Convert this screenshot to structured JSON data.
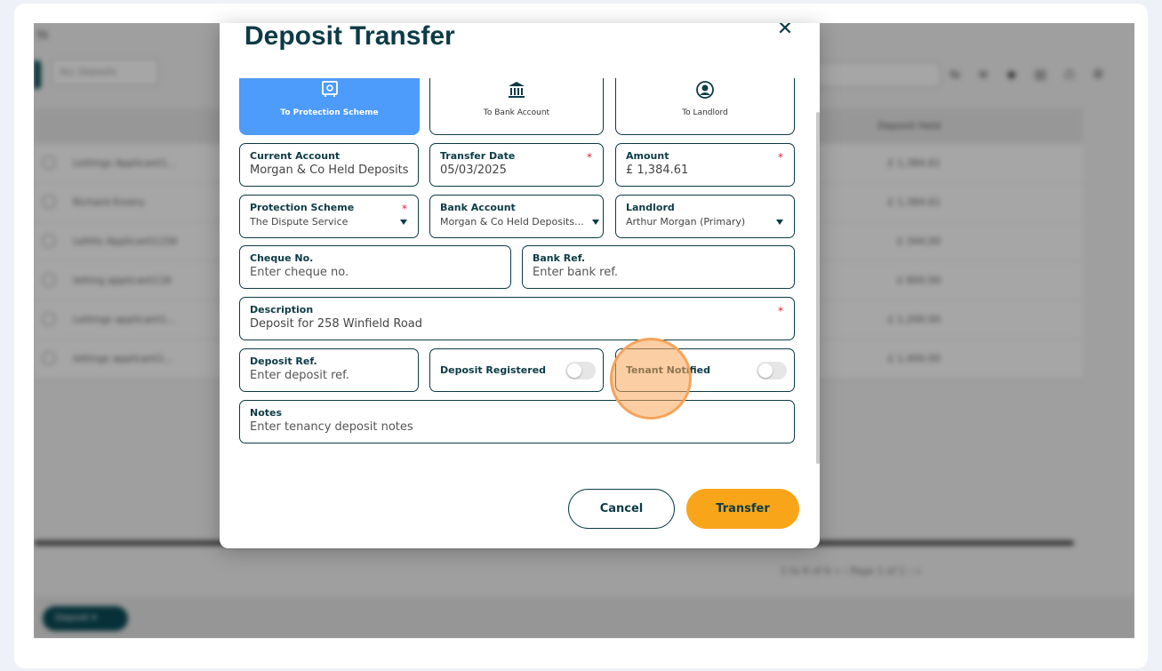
{
  "background": {
    "title": "ts",
    "search_placeholder": "ALL Deposits",
    "rows": [
      {
        "name": "Lettings Applicant1...",
        "amount": "£ 1,384.61"
      },
      {
        "name": "Richard Emery",
        "amount": "£ 1,384.61"
      },
      {
        "name": "LetHis Applicant1156",
        "amount": "£ 344.00"
      },
      {
        "name": "letting applicant116",
        "amount": "£ 800.00"
      },
      {
        "name": "Lettings applicant1...",
        "amount": "£ 1,200.00"
      },
      {
        "name": "lettings applicant1...",
        "amount": "£ 1,400.00"
      }
    ],
    "header_amount": "Deposit Held",
    "pager": "1 to 6 of 6     «  ‹  Page 1 of 1  ›  »",
    "footer_pill": "Deposit ▾"
  },
  "modal": {
    "title": "Deposit Transfer",
    "close_icon": "close-icon",
    "tabs": [
      {
        "label": "To Protection Scheme",
        "icon": "safe-icon",
        "active": true
      },
      {
        "label": "To Bank Account",
        "icon": "bank-icon",
        "active": false
      },
      {
        "label": "To Landlord",
        "icon": "user-circle-icon",
        "active": false
      }
    ],
    "fields": {
      "current_account": {
        "label": "Current Account",
        "value": "Morgan & Co Held Deposits"
      },
      "transfer_date": {
        "label": "Transfer Date",
        "value": "05/03/2025",
        "required": "*"
      },
      "amount": {
        "label": "Amount",
        "value": "£ 1,384.61",
        "required": "*"
      },
      "protection_scheme": {
        "label": "Protection Scheme",
        "value": "The Dispute Service",
        "required": "*"
      },
      "bank_account": {
        "label": "Bank Account",
        "value": "Morgan & Co Held Deposits..."
      },
      "landlord": {
        "label": "Landlord",
        "value": "Arthur Morgan (Primary)"
      },
      "cheque_no": {
        "label": "Cheque No.",
        "placeholder": "Enter cheque no."
      },
      "bank_ref": {
        "label": "Bank Ref.",
        "placeholder": "Enter bank ref."
      },
      "description": {
        "label": "Description",
        "value": "Deposit for 258 Winfield Road",
        "required": "*"
      },
      "deposit_ref": {
        "label": "Deposit Ref.",
        "placeholder": "Enter deposit ref."
      },
      "notes": {
        "label": "Notes",
        "placeholder": "Enter tenancy deposit notes"
      }
    },
    "toggles": {
      "deposit_registered": {
        "label": "Deposit Registered",
        "on": false
      },
      "tenant_notified": {
        "label": "Tenant Notified",
        "on": false
      }
    },
    "buttons": {
      "cancel": "Cancel",
      "transfer": "Transfer"
    }
  },
  "colors": {
    "brand_dark": "#0c3b45",
    "active_tab": "#4d9bfa",
    "transfer_button": "#f9a51a",
    "required": "#e0223c"
  }
}
